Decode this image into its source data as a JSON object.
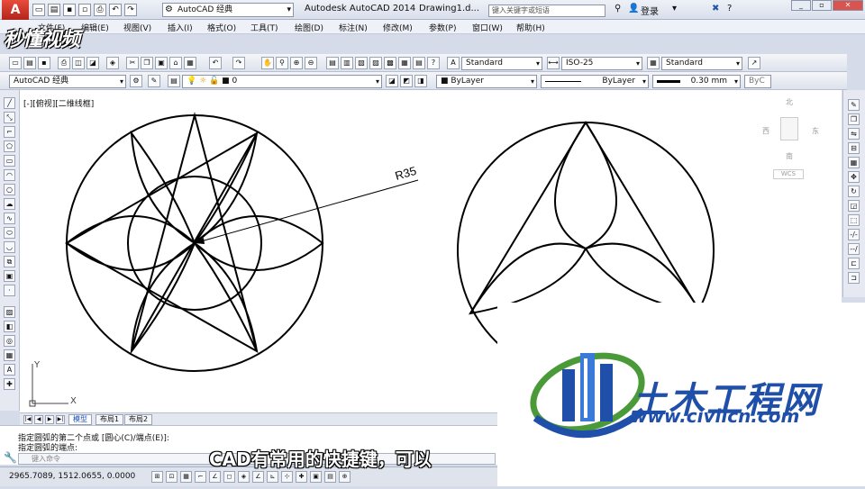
{
  "window": {
    "app_button": "A",
    "workspace": "AutoCAD 经典",
    "title": "Autodesk AutoCAD 2014",
    "document": "Drawing1.d...",
    "search_placeholder": "键入关键字或短语",
    "signin": "登录"
  },
  "watermark": {
    "brand": "秒懂视频"
  },
  "menu": {
    "items": [
      "文件(F)",
      "编辑(E)",
      "视图(V)",
      "插入(I)",
      "格式(O)",
      "工具(T)",
      "绘图(D)",
      "标注(N)",
      "修改(M)",
      "参数(P)",
      "窗口(W)",
      "帮助(H)"
    ]
  },
  "styles_toolbar": {
    "text_style": "Standard",
    "dim_style": "ISO-25",
    "table_style": "Standard"
  },
  "layers_toolbar": {
    "workspace": "AutoCAD 经典",
    "layer": "0",
    "color": "ByLayer",
    "linetype": "ByLayer",
    "lineweight": "0.30 mm",
    "plot_style": "ByC"
  },
  "viewport": {
    "label": "[-][俯视][二维线框]"
  },
  "viewcube": {
    "north": "北",
    "west": "西",
    "east": "东",
    "south": "南",
    "wcs": "WCS"
  },
  "drawing": {
    "dimension_text": "R35",
    "ucs_x": "X",
    "ucs_y": "Y"
  },
  "layout_tabs": [
    "模型",
    "布局1",
    "布局2"
  ],
  "command": {
    "line1": "指定圆弧的第二个点或 [圆心(C)/端点(E)]:",
    "line2": "指定圆弧的端点:",
    "placeholder": "键入命令"
  },
  "status": {
    "coords": "2965.7089,  1512.0655,  0.0000"
  },
  "caption": "CAD有常用的快捷键，可以",
  "logo": {
    "name": "土木工程网",
    "url": "www.civilcn.com"
  }
}
